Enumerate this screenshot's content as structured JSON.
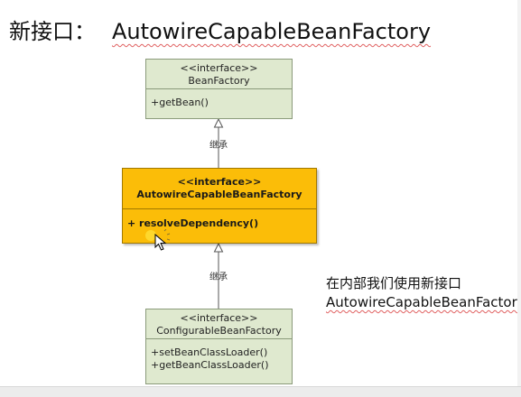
{
  "title": {
    "prefix": "新接口：",
    "class_name": "AutowireCapableBeanFactory"
  },
  "nodes": [
    {
      "stereotype": "<<interface>>",
      "name": "BeanFactory",
      "methods": [
        "+getBean()"
      ]
    },
    {
      "stereotype": "<<interface>>",
      "name": "AutowireCapableBeanFactory",
      "methods": [
        "+ resolveDependency()"
      ]
    },
    {
      "stereotype": "<<interface>>",
      "name": "ConfigurableBeanFactory",
      "methods": [
        "+setBeanClassLoader()",
        "+getBeanClassLoader()"
      ]
    }
  ],
  "edges": [
    {
      "from": "AutowireCapableBeanFactory",
      "to": "BeanFactory",
      "label": "继承"
    },
    {
      "from": "ConfigurableBeanFactory",
      "to": "AutowireCapableBeanFactory",
      "label": "继承"
    }
  ],
  "note": {
    "line1": "在内部我们使用新接口",
    "line2": "AutowireCapableBeanFactory"
  },
  "colors": {
    "node_fill": "#dfe9cf",
    "node_border": "#8a9a7a",
    "focus_fill": "#fbbd08",
    "focus_border": "#a07800",
    "wavy_underline": "#e06060"
  }
}
